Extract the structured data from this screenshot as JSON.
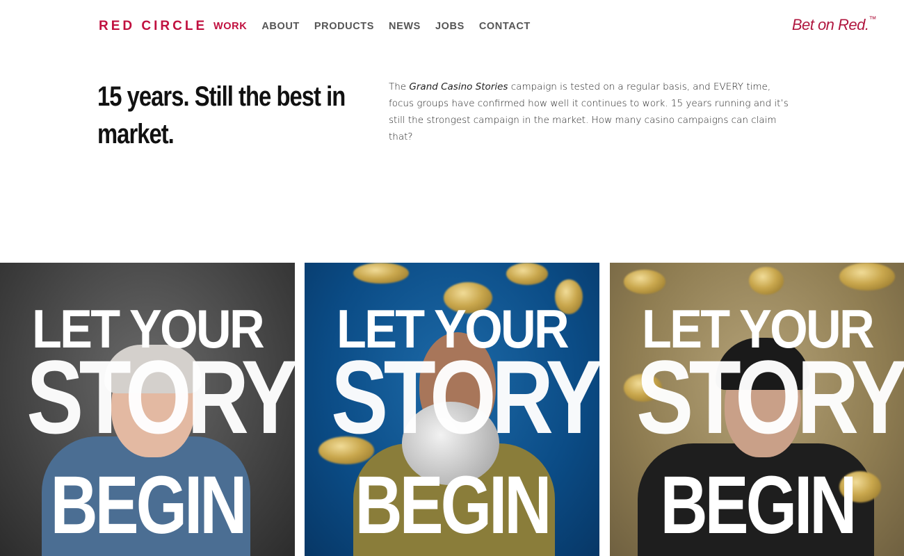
{
  "header": {
    "brand": "RED CIRCLE",
    "nav": [
      "WORK",
      "ABOUT",
      "PRODUCTS",
      "NEWS",
      "JOBS",
      "CONTACT"
    ],
    "active_nav": "WORK",
    "tagline": "Bet on Red.",
    "tagline_mark": "™"
  },
  "intro": {
    "headline": "15 years. Still the best in market.",
    "body_prefix": "The ",
    "body_italic": "Grand Casino Stories",
    "body_suffix": " campaign is tested on a regular basis, and EVERY time, focus groups have confirmed how well it continues to work. 15 years running and it’s still the strongest campaign in the market. How many casino campaigns can claim that?"
  },
  "posters": [
    {
      "line1": "LET YOUR",
      "line2": "STORY",
      "line3": "BEGIN"
    },
    {
      "line1": "LET YOUR",
      "line2": "STORY",
      "line3": "BEGIN"
    },
    {
      "line1": "LET YOUR",
      "line2": "STORY",
      "line3": "BEGIN"
    }
  ],
  "colors": {
    "brand_red": "#c0103f",
    "poster_gray": "#3e3e3e",
    "poster_blue": "#0b4c86",
    "poster_gold": "#8f7d52"
  }
}
